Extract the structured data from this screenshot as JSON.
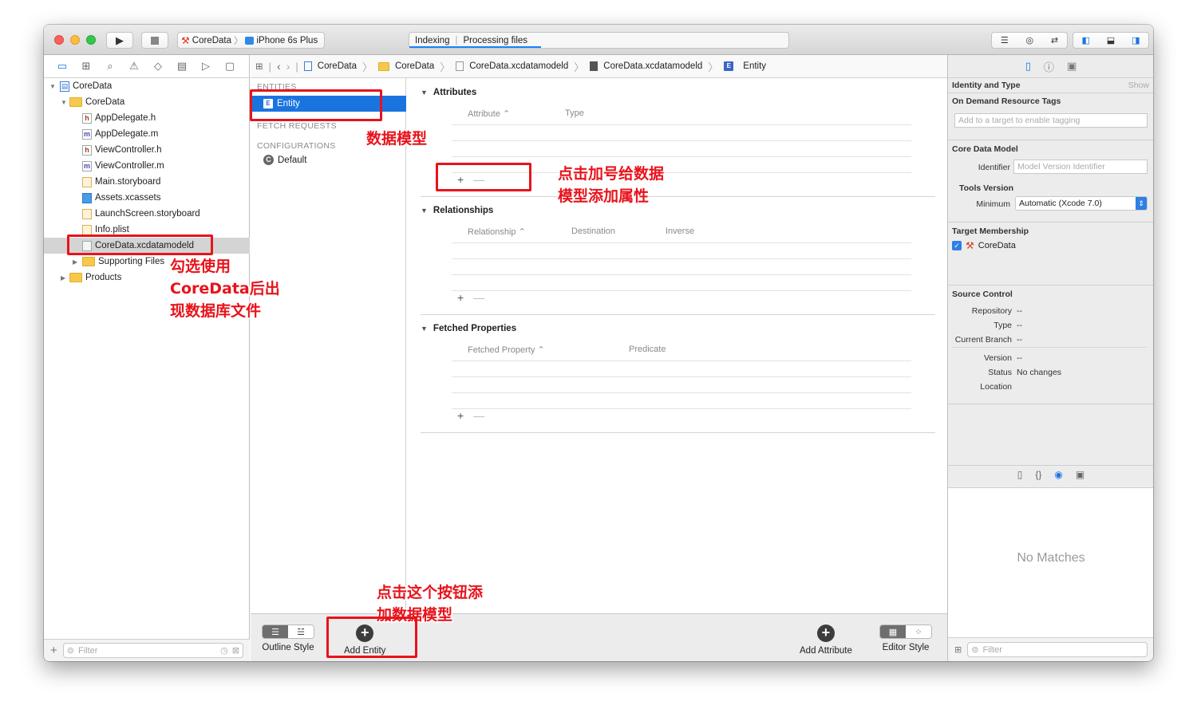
{
  "toolbar": {
    "scheme_target": "CoreData",
    "scheme_device": "iPhone 6s Plus",
    "activity_status": "Indexing",
    "activity_detail": "Processing files"
  },
  "navigator": {
    "items": [
      {
        "label": "CoreData",
        "kind": "project",
        "level": 0,
        "expanded": true
      },
      {
        "label": "CoreData",
        "kind": "folder",
        "level": 1,
        "expanded": true
      },
      {
        "label": "AppDelegate.h",
        "kind": "h",
        "level": 2
      },
      {
        "label": "AppDelegate.m",
        "kind": "m",
        "level": 2
      },
      {
        "label": "ViewController.h",
        "kind": "h",
        "level": 2
      },
      {
        "label": "ViewController.m",
        "kind": "m",
        "level": 2
      },
      {
        "label": "Main.storyboard",
        "kind": "storyboard",
        "level": 2
      },
      {
        "label": "Assets.xcassets",
        "kind": "assets",
        "level": 2
      },
      {
        "label": "LaunchScreen.storyboard",
        "kind": "storyboard",
        "level": 2
      },
      {
        "label": "Info.plist",
        "kind": "plist",
        "level": 2
      },
      {
        "label": "CoreData.xcdatamodeld",
        "kind": "datamodel",
        "level": 2,
        "selected": true
      },
      {
        "label": "Supporting Files",
        "kind": "folder",
        "level": 2,
        "expanded": false
      },
      {
        "label": "Products",
        "kind": "folder",
        "level": 1,
        "expanded": false
      }
    ],
    "filter_placeholder": "Filter"
  },
  "jumpbar": {
    "crumbs": [
      "CoreData",
      "CoreData",
      "CoreData.xcdatamodeld",
      "CoreData.xcdatamodeld",
      "Entity"
    ]
  },
  "entities_panel": {
    "entities_header": "ENTITIES",
    "selected_entity": "Entity",
    "fetch_requests_header": "FETCH REQUESTS",
    "configurations_header": "CONFIGURATIONS",
    "configuration_default": "Default"
  },
  "editor": {
    "attributes": {
      "title": "Attributes",
      "col1": "Attribute",
      "col2": "Type"
    },
    "relationships": {
      "title": "Relationships",
      "col1": "Relationship",
      "col2": "Destination",
      "col3": "Inverse"
    },
    "fetched": {
      "title": "Fetched Properties",
      "col1": "Fetched Property",
      "col2": "Predicate"
    },
    "plus": "+",
    "minus": "—"
  },
  "bottom_bar": {
    "outline_style": "Outline Style",
    "add_entity": "Add Entity",
    "add_attribute": "Add Attribute",
    "editor_style": "Editor Style"
  },
  "inspector": {
    "identity_type": "Identity and Type",
    "show": "Show",
    "on_demand": "On Demand Resource Tags",
    "tags_placeholder": "Add to a target to enable tagging",
    "core_data_model": "Core Data Model",
    "identifier_label": "Identifier",
    "identifier_placeholder": "Model Version Identifier",
    "tools_version": "Tools Version",
    "minimum_label": "Minimum",
    "minimum_value": "Automatic (Xcode 7.0)",
    "target_membership": "Target Membership",
    "target_name": "CoreData",
    "source_control": "Source Control",
    "repository_label": "Repository",
    "repository_value": "--",
    "type_label": "Type",
    "type_value": "--",
    "branch_label": "Current Branch",
    "branch_value": "--",
    "version_label": "Version",
    "version_value": "--",
    "status_label": "Status",
    "status_value": "No changes",
    "location_label": "Location",
    "no_matches": "No Matches",
    "filter_placeholder": "Filter"
  },
  "annotations": {
    "data_model": "数据模型",
    "add_attr_line1": "点击加号给数据",
    "add_attr_line2": "模型添加属性",
    "check_line1": "勾选使用",
    "check_line2": "CoreData后出",
    "check_line3": "现数据库文件",
    "add_entity_line1": "点击这个按钮添",
    "add_entity_line2": "加数据模型"
  },
  "colors": {
    "selection_blue": "#1a74e0",
    "annotation_red": "#e8131b",
    "folder_yellow": "#f7c94a"
  }
}
